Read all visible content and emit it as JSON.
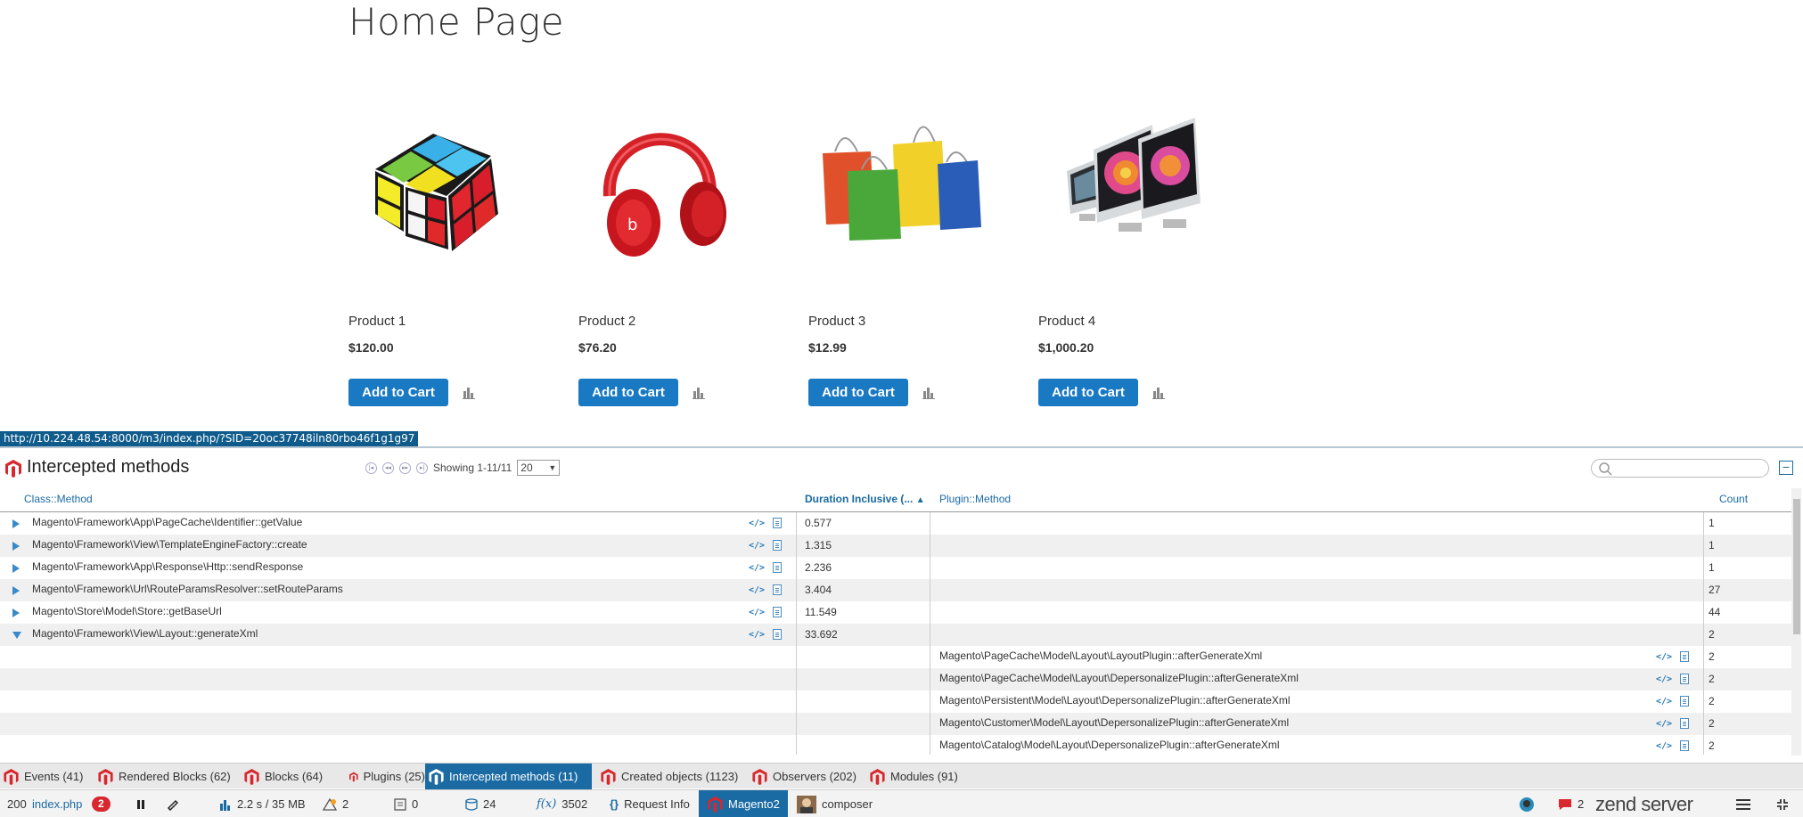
{
  "page": {
    "title": "Home Page",
    "products": [
      {
        "name": "Product 1",
        "price": "$120.00",
        "cart_label": "Add to Cart",
        "image": "rubiks-cube"
      },
      {
        "name": "Product 2",
        "price": "$76.20",
        "cart_label": "Add to Cart",
        "image": "red-headphones"
      },
      {
        "name": "Product 3",
        "price": "$12.99",
        "cart_label": "Add to Cart",
        "image": "shopping-bags"
      },
      {
        "name": "Product 4",
        "price": "$1,000.20",
        "cart_label": "Add to Cart",
        "image": "imac-computers"
      }
    ]
  },
  "url_tooltip": "http://10.224.48.54:8000/m3/index.php/?SID=20oc37748iln80rbo46f1g1g97",
  "panel": {
    "title": "Intercepted methods",
    "showing": "Showing 1-11/11",
    "page_size": "20",
    "search_placeholder": ""
  },
  "table": {
    "headers": {
      "class_method": "Class::Method",
      "duration": "Duration Inclusive (...",
      "sort_indicator": "▲",
      "plugin_method": "Plugin::Method",
      "count": "Count"
    },
    "rows": [
      {
        "class_method": "Magento\\Framework\\App\\PageCache\\Identifier::getValue",
        "duration": "0.577",
        "plugin": "",
        "count": "1",
        "expanded": false
      },
      {
        "class_method": "Magento\\Framework\\View\\TemplateEngineFactory::create",
        "duration": "1.315",
        "plugin": "",
        "count": "1",
        "expanded": false
      },
      {
        "class_method": "Magento\\Framework\\App\\Response\\Http::sendResponse",
        "duration": "2.236",
        "plugin": "",
        "count": "1",
        "expanded": false
      },
      {
        "class_method": "Magento\\Framework\\Url\\RouteParamsResolver::setRouteParams",
        "duration": "3.404",
        "plugin": "",
        "count": "27",
        "expanded": false
      },
      {
        "class_method": "Magento\\Store\\Model\\Store::getBaseUrl",
        "duration": "11.549",
        "plugin": "",
        "count": "44",
        "expanded": false
      },
      {
        "class_method": "Magento\\Framework\\View\\Layout::generateXml",
        "duration": "33.692",
        "plugin": "",
        "count": "2",
        "expanded": true
      },
      {
        "class_method": "",
        "duration": "",
        "plugin": "Magento\\PageCache\\Model\\Layout\\LayoutPlugin::afterGenerateXml",
        "count": "2",
        "expanded": null
      },
      {
        "class_method": "",
        "duration": "",
        "plugin": "Magento\\PageCache\\Model\\Layout\\DepersonalizePlugin::afterGenerateXml",
        "count": "2",
        "expanded": null
      },
      {
        "class_method": "",
        "duration": "",
        "plugin": "Magento\\Persistent\\Model\\Layout\\DepersonalizePlugin::afterGenerateXml",
        "count": "2",
        "expanded": null
      },
      {
        "class_method": "",
        "duration": "",
        "plugin": "Magento\\Customer\\Model\\Layout\\DepersonalizePlugin::afterGenerateXml",
        "count": "2",
        "expanded": null
      },
      {
        "class_method": "",
        "duration": "",
        "plugin": "Magento\\Catalog\\Model\\Layout\\DepersonalizePlugin::afterGenerateXml",
        "count": "2",
        "expanded": null
      }
    ]
  },
  "tabs": [
    {
      "label": "Events (41)",
      "active": false
    },
    {
      "label": "Rendered Blocks (62)",
      "active": false
    },
    {
      "label": "Blocks (64)",
      "active": false
    },
    {
      "label": "Plugins (25)",
      "active": false
    },
    {
      "label": "Intercepted methods (11)",
      "active": true
    },
    {
      "label": "Created objects (1123)",
      "active": false
    },
    {
      "label": "Observers (202)",
      "active": false
    },
    {
      "label": "Modules (91)",
      "active": false
    }
  ],
  "statusbar": {
    "status_code": "200",
    "script": "index.php",
    "error_count": "2",
    "time_memory": "2.2 s / 35 MB",
    "warnings": "2",
    "log_count": "0",
    "db_queries": "24",
    "functions": "3502",
    "request_info": "Request Info",
    "magento": "Magento2",
    "composer": "composer",
    "notifications": "2",
    "brand": "zend server",
    "colors": {
      "accent": "#1a6aa3",
      "magento": "#d8282e",
      "cart_button": "#1979c3"
    }
  }
}
